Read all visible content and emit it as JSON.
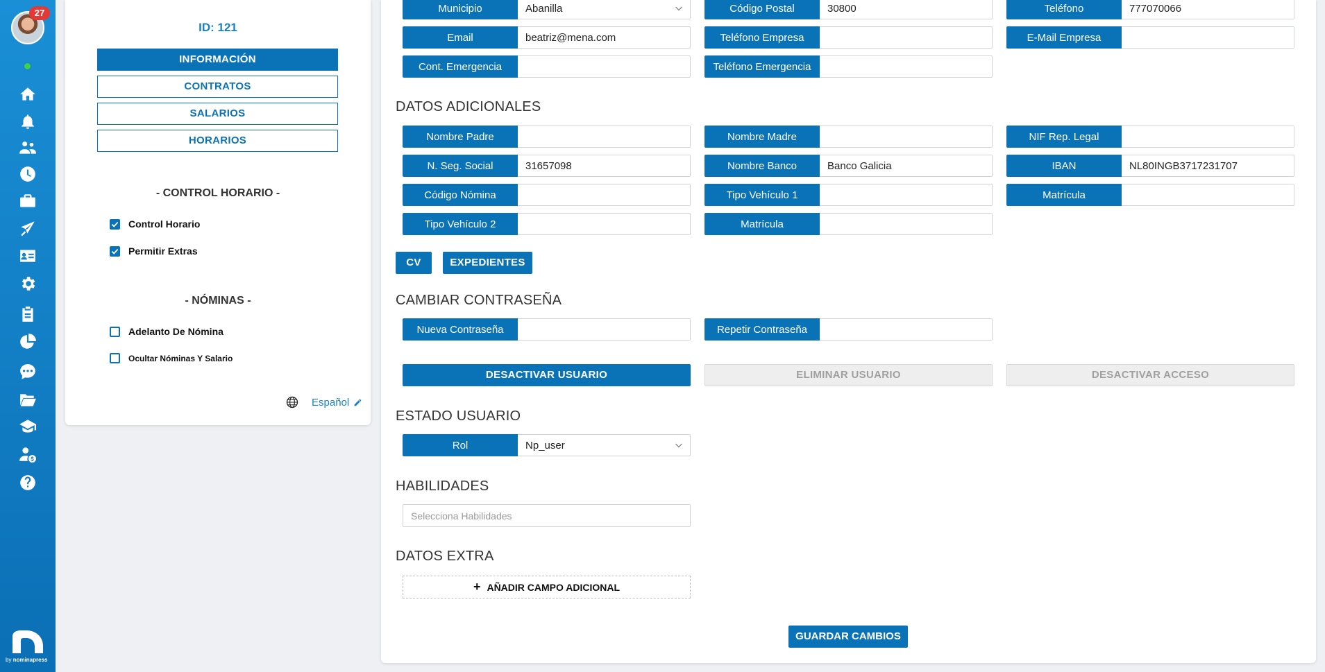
{
  "sidebar": {
    "notification_count": "27",
    "icons": [
      "home-icon",
      "bell-icon",
      "users-icon",
      "clock-icon",
      "briefcase-icon",
      "plane-icon",
      "id-card-icon",
      "gear-icon",
      "clipboard-icon",
      "pie-chart-icon",
      "chat-icon",
      "folder-icon",
      "graduation-cap-icon",
      "user-money-icon",
      "help-icon"
    ],
    "brand_prefix": "by",
    "brand_name": "nominapress"
  },
  "left_panel": {
    "user_id": "ID: 121",
    "nav": [
      {
        "label": "INFORMACIÓN",
        "active": true
      },
      {
        "label": "CONTRATOS",
        "active": false
      },
      {
        "label": "SALARIOS",
        "active": false
      },
      {
        "label": "HORARIOS",
        "active": false
      }
    ],
    "control_title": "- CONTROL HORARIO -",
    "control_options": [
      {
        "label": "Control Horario",
        "checked": true
      },
      {
        "label": "Permitir Extras",
        "checked": true
      }
    ],
    "payroll_title": "- NÓMINAS -",
    "payroll_options": [
      {
        "label": "Adelanto De Nómina",
        "checked": false
      },
      {
        "label": "Ocultar Nóminas Y Salario",
        "checked": false
      }
    ],
    "language": "Español"
  },
  "main": {
    "contact": [
      {
        "label": "Municipio",
        "value": "Abanilla",
        "dropdown": true
      },
      {
        "label": "Código Postal",
        "value": "30800"
      },
      {
        "label": "Teléfono",
        "value": "777070066"
      },
      {
        "label": "Email",
        "value": "beatriz@mena.com"
      },
      {
        "label": "Teléfono Empresa",
        "value": ""
      },
      {
        "label": "E-Mail Empresa",
        "value": ""
      },
      {
        "label": "Cont. Emergencia",
        "value": ""
      },
      {
        "label": "Teléfono Emergencia",
        "value": ""
      }
    ],
    "extra_heading": "DATOS ADICIONALES",
    "extra": [
      {
        "label": "Nombre Padre",
        "value": ""
      },
      {
        "label": "Nombre Madre",
        "value": ""
      },
      {
        "label": "NIF Rep. Legal",
        "value": ""
      },
      {
        "label": "N. Seg. Social",
        "value": "31657098"
      },
      {
        "label": "Nombre Banco",
        "value": "Banco Galicia"
      },
      {
        "label": "IBAN",
        "value": "NL80INGB3717231707"
      },
      {
        "label": "Código Nómina",
        "value": ""
      },
      {
        "label": "Tipo Vehículo 1",
        "value": ""
      },
      {
        "label": "Matrícula",
        "value": ""
      },
      {
        "label": "Tipo Vehículo 2",
        "value": ""
      },
      {
        "label": "Matrícula",
        "value": ""
      }
    ],
    "cv_button": "CV",
    "files_button": "EXPEDIENTES",
    "password_heading": "CAMBIAR CONTRASEÑA",
    "new_password_label": "Nueva Contraseña",
    "repeat_password_label": "Repetir Contraseña",
    "deactivate_user": "DESACTIVAR USUARIO",
    "delete_user": "ELIMINAR USUARIO",
    "deactivate_access": "DESACTIVAR ACCESO",
    "status_heading": "ESTADO USUARIO",
    "role_label": "Rol",
    "role_value": "Np_user",
    "skills_heading": "HABILIDADES",
    "skills_placeholder": "Selecciona Habilidades",
    "extra_data_heading": "DATOS EXTRA",
    "add_field": "AÑADIR CAMPO ADICIONAL",
    "save": "GUARDAR CAMBIOS"
  },
  "colors": {
    "primary": "#0a73b8",
    "sidebar": "#1a8fd6",
    "badge": "#e53935",
    "online": "#3ed24a"
  }
}
